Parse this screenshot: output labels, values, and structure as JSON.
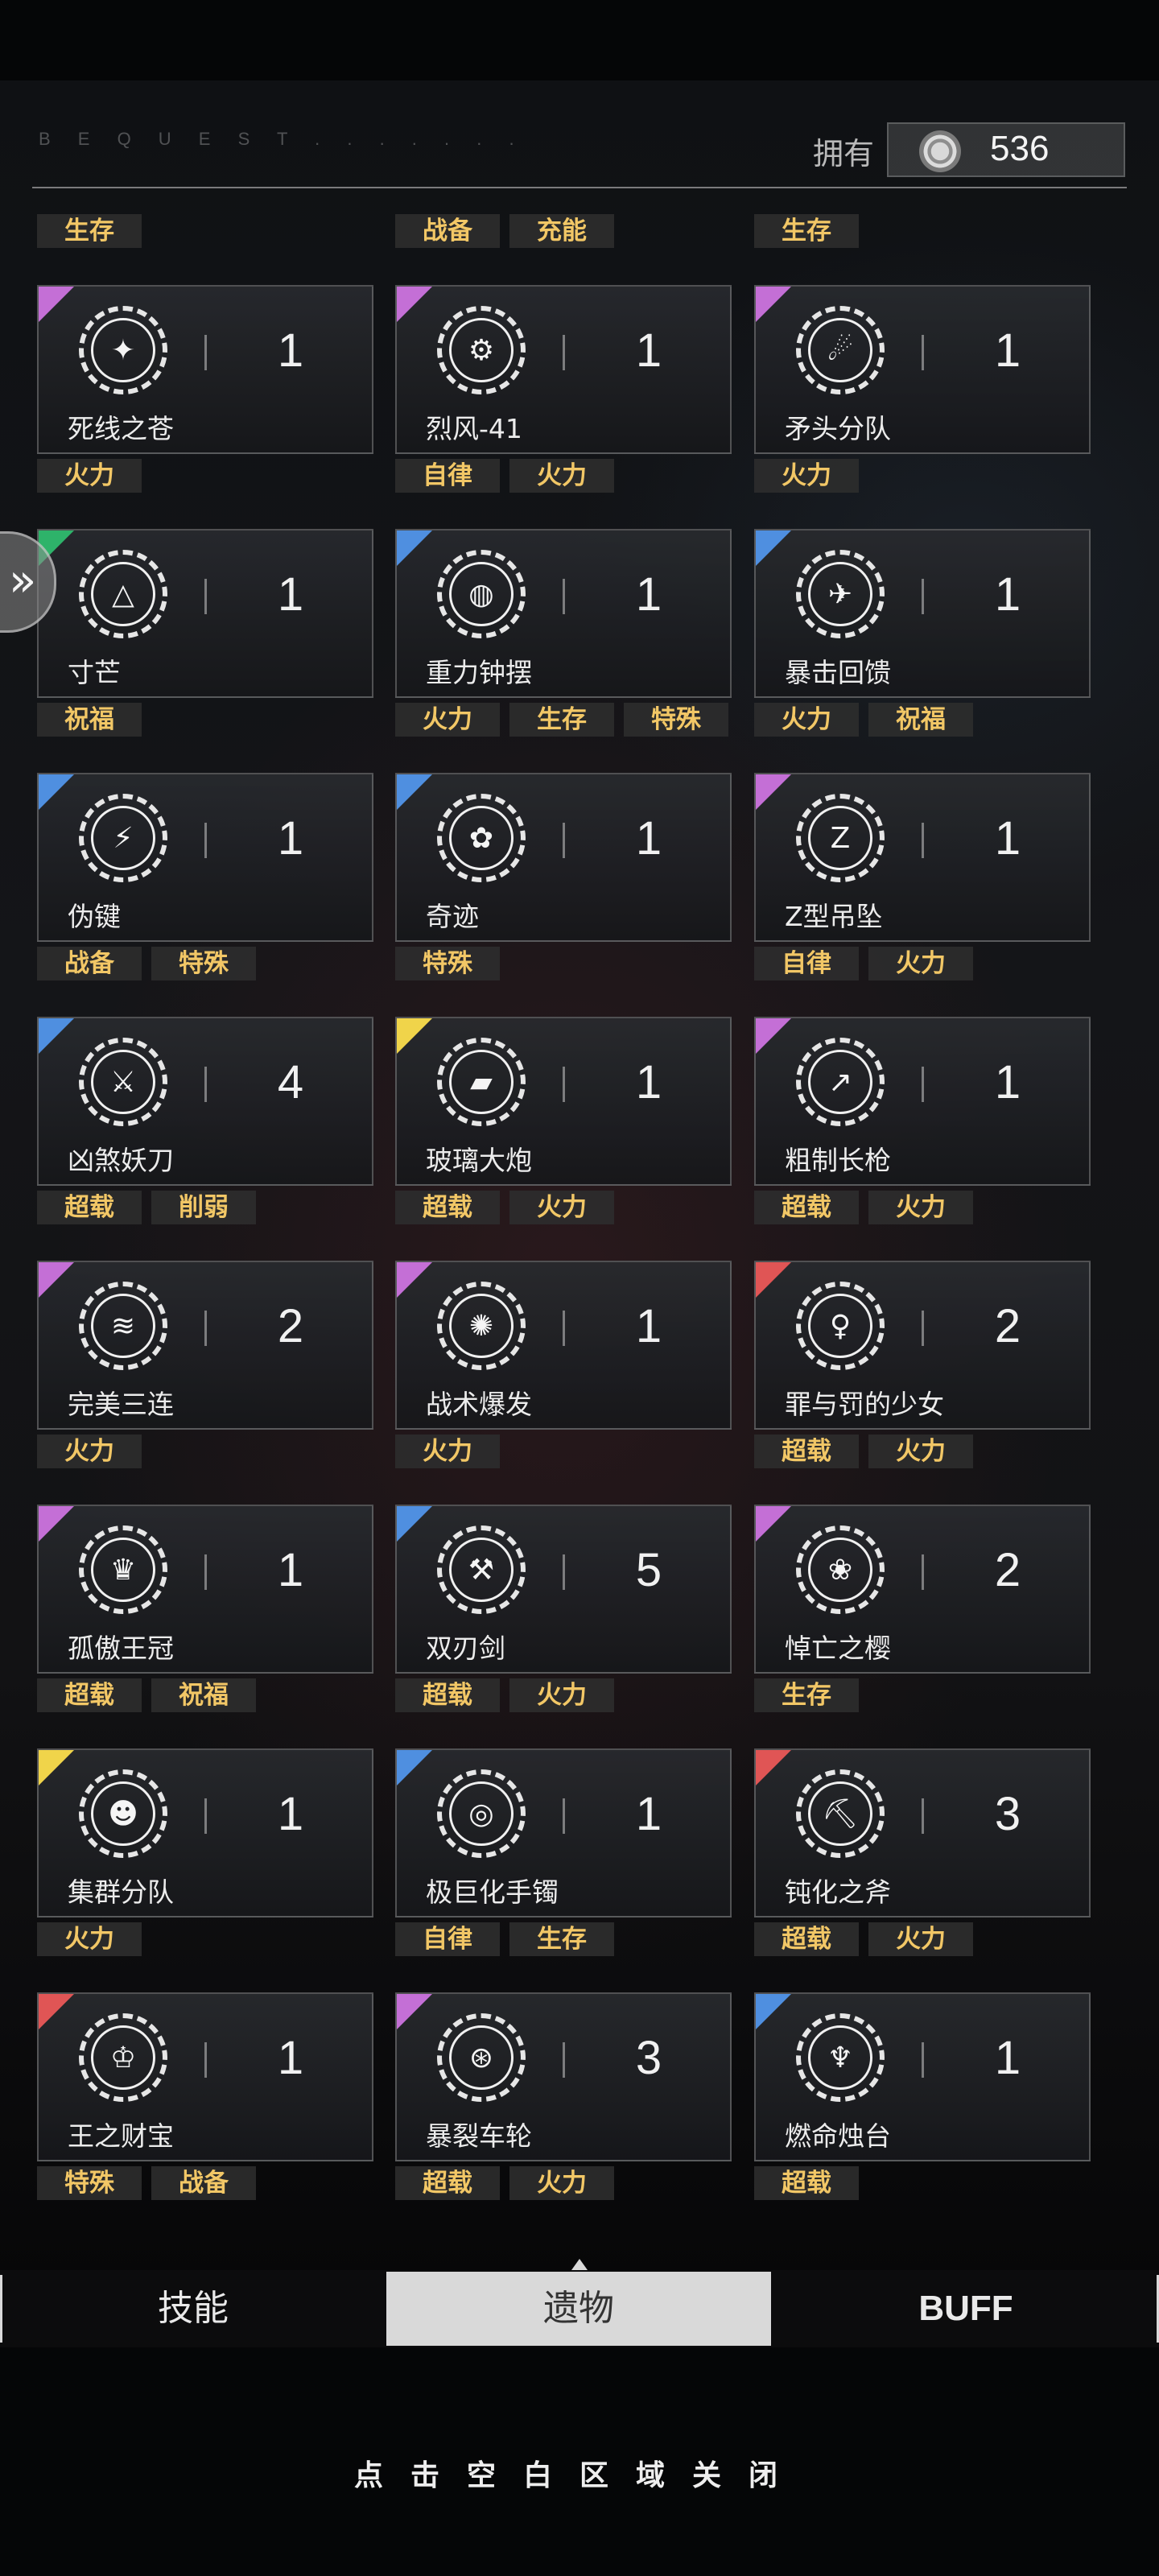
{
  "header": {
    "subtitle": "B E Q U E S T . . . . . . .",
    "owned_label": "拥有",
    "currency_value": "536"
  },
  "top_tags": [
    [
      "生存"
    ],
    [
      "战备",
      "充能"
    ],
    [
      "生存"
    ]
  ],
  "colors": {
    "tag_text": "#f2c766",
    "corner_purple": "#c46fd6",
    "corner_blue": "#4f8fe0",
    "corner_green": "#2eb36a",
    "corner_yellow": "#f0d44a",
    "corner_red": "#e05555"
  },
  "relics": [
    {
      "name": "死线之苍",
      "count": "1",
      "icon": "star-compass-icon",
      "corner": "purple",
      "tags": [
        "火力"
      ]
    },
    {
      "name": "烈风-41",
      "count": "1",
      "icon": "bomb-icon",
      "corner": "purple",
      "tags": [
        "自律",
        "火力"
      ]
    },
    {
      "name": "矛头分队",
      "count": "1",
      "icon": "soldier-spear-icon",
      "corner": "purple",
      "tags": [
        "火力"
      ]
    },
    {
      "name": "寸芒",
      "count": "1",
      "icon": "triangle-blades-icon",
      "corner": "green",
      "tags": [
        "祝福"
      ]
    },
    {
      "name": "重力钟摆",
      "count": "1",
      "icon": "pendulum-icon",
      "corner": "blue",
      "tags": [
        "火力",
        "生存",
        "特殊"
      ]
    },
    {
      "name": "暴击回馈",
      "count": "1",
      "icon": "winged-hand-icon",
      "corner": "blue",
      "tags": [
        "火力",
        "祝福"
      ]
    },
    {
      "name": "伪键",
      "count": "1",
      "icon": "cracked-orb-icon",
      "corner": "blue",
      "tags": [
        "战备",
        "特殊"
      ]
    },
    {
      "name": "奇迹",
      "count": "1",
      "icon": "flower-icon",
      "corner": "blue",
      "tags": [
        "特殊"
      ]
    },
    {
      "name": "Z型吊坠",
      "count": "1",
      "icon": "z-pendant-icon",
      "corner": "purple",
      "tags": [
        "自律",
        "火力"
      ]
    },
    {
      "name": "凶煞妖刀",
      "count": "4",
      "icon": "demon-blade-icon",
      "corner": "blue",
      "tags": [
        "超载",
        "削弱"
      ]
    },
    {
      "name": "玻璃大炮",
      "count": "1",
      "icon": "cannon-icon",
      "corner": "yellow",
      "tags": [
        "超载",
        "火力"
      ]
    },
    {
      "name": "粗制长枪",
      "count": "1",
      "icon": "crude-spear-icon",
      "corner": "purple",
      "tags": [
        "超载",
        "火力"
      ]
    },
    {
      "name": "完美三连",
      "count": "2",
      "icon": "triple-slash-icon",
      "corner": "purple",
      "tags": [
        "火力"
      ]
    },
    {
      "name": "战术爆发",
      "count": "1",
      "icon": "tactical-burst-icon",
      "corner": "purple",
      "tags": [
        "火力"
      ]
    },
    {
      "name": "罪与罚的少女",
      "count": "2",
      "icon": "maiden-icon",
      "corner": "red",
      "tags": [
        "超载",
        "火力"
      ]
    },
    {
      "name": "孤傲王冠",
      "count": "1",
      "icon": "crown-icon",
      "corner": "purple",
      "tags": [
        "超载",
        "祝福"
      ]
    },
    {
      "name": "双刃剑",
      "count": "5",
      "icon": "double-edged-sword-icon",
      "corner": "blue",
      "tags": [
        "超载",
        "火力"
      ]
    },
    {
      "name": "悼亡之樱",
      "count": "2",
      "icon": "sakura-icon",
      "corner": "purple",
      "tags": [
        "生存"
      ]
    },
    {
      "name": "集群分队",
      "count": "1",
      "icon": "squad-icon",
      "corner": "yellow",
      "tags": [
        "火力"
      ]
    },
    {
      "name": "极巨化手镯",
      "count": "1",
      "icon": "bracelet-icon",
      "corner": "blue",
      "tags": [
        "自律",
        "生存"
      ]
    },
    {
      "name": "钝化之斧",
      "count": "3",
      "icon": "axe-icon",
      "corner": "red",
      "tags": [
        "超载",
        "火力"
      ]
    },
    {
      "name": "王之财宝",
      "count": "1",
      "icon": "treasure-icon",
      "corner": "red",
      "tags": [
        "特殊",
        "战备"
      ]
    },
    {
      "name": "暴裂车轮",
      "count": "3",
      "icon": "wheel-icon",
      "corner": "purple",
      "tags": [
        "超载",
        "火力"
      ]
    },
    {
      "name": "燃命烛台",
      "count": "1",
      "icon": "candelabra-icon",
      "corner": "blue",
      "tags": [
        "超载"
      ]
    }
  ],
  "icon_glyphs": {
    "star-compass-icon": "✦",
    "bomb-icon": "⚙",
    "soldier-spear-icon": "☄",
    "triangle-blades-icon": "△",
    "pendulum-icon": "◍",
    "winged-hand-icon": "✈",
    "cracked-orb-icon": "⚡",
    "flower-icon": "✿",
    "z-pendant-icon": "Z",
    "demon-blade-icon": "⚔",
    "cannon-icon": "▰",
    "crude-spear-icon": "↗",
    "triple-slash-icon": "≋",
    "tactical-burst-icon": "✺",
    "maiden-icon": "♀",
    "crown-icon": "♛",
    "double-edged-sword-icon": "⚒",
    "sakura-icon": "❀",
    "squad-icon": "☻",
    "bracelet-icon": "◎",
    "axe-icon": "⛏",
    "treasure-icon": "♔",
    "wheel-icon": "⊛",
    "candelabra-icon": "♆"
  },
  "tabs": [
    {
      "label": "技能",
      "active": false
    },
    {
      "label": "遗物",
      "active": true
    },
    {
      "label": "BUFF",
      "active": false
    }
  ],
  "footer": {
    "close_hint": "点击空白区域关闭"
  }
}
